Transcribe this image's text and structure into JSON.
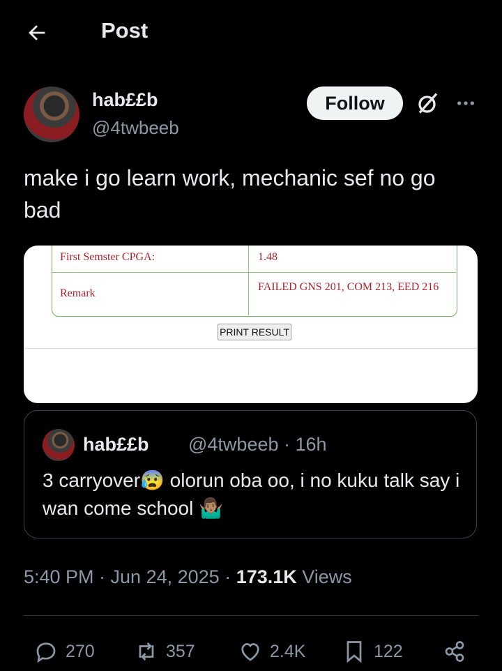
{
  "header": {
    "title": "Post"
  },
  "author": {
    "name": "hab££b",
    "handle": "@4twbeeb",
    "follow_label": "Follow"
  },
  "tweet": {
    "text": "make i go learn work, mechanic sef no go bad"
  },
  "media": {
    "rows": [
      {
        "label": "First Semster CPGA:",
        "value": "1.48"
      },
      {
        "label": "Remark",
        "value": "FAILED GNS 201, COM 213, EED 216"
      }
    ],
    "print_label": "PRINT RESULT"
  },
  "quote": {
    "name": "hab££b",
    "meta": "@4twbeeb · 16h",
    "text": "3 carryover😰 olorun oba oo, i no kuku talk say i wan come school 🤷🏽‍♂️"
  },
  "timestamp": {
    "time": "5:40 PM · Jun 24, 2025 · ",
    "views": "173.1K",
    "views_label": " Views"
  },
  "actions": {
    "replies": "270",
    "reposts": "357",
    "likes": "2.4K",
    "bookmarks": "122"
  }
}
